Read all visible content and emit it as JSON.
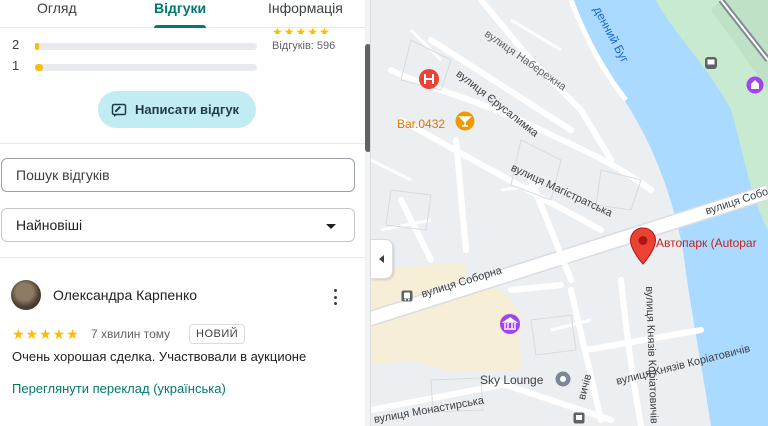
{
  "tabs": [
    {
      "label": "Огляд",
      "active": false
    },
    {
      "label": "Відгуки",
      "active": true
    },
    {
      "label": "Інформація",
      "active": false
    }
  ],
  "histogram": [
    {
      "label": "2",
      "fraction": 0.012
    },
    {
      "label": "1",
      "fraction": 0.035
    }
  ],
  "rating_summary": {
    "stars": "★★★★★",
    "reviews_label": "Відгуків:",
    "reviews_count": "596"
  },
  "write_review": {
    "label": "Написати відгук",
    "icon": "edit-review-icon"
  },
  "search": {
    "placeholder": "Пошук відгуків",
    "value": ""
  },
  "sort": {
    "selected": "Найновіші"
  },
  "review": {
    "author": "Олександра Карпенко",
    "stars": "★★★★★",
    "time": "7 хвилин тому",
    "badge": "НОВИЙ",
    "text": "Очень хорошая сделка. Участвовали в аукционе",
    "translate_link": "Переглянути переклад (українська)"
  },
  "map": {
    "labels": {
      "river": "денний Буг",
      "street_naberezhna": "вулиця Набережна",
      "street_yerusalymka": "вулиця Єрусалимка",
      "bar": "Bar.0432",
      "street_mahistratska": "вулиця Магістратська",
      "street_soborna_right": "вулиця Собо",
      "street_soborna": "вулиця Соборна",
      "place_name": "Автопарк (Autopar",
      "street_koriatovychiv": "вулиця Князів Коріатовичів",
      "sky_lounge": "Sky Lounge",
      "street_monastyrska": "вулиця Монастирська",
      "street_small": "вичів"
    },
    "icons": [
      "hospital-icon",
      "bar-icon",
      "bus-stop-icon",
      "museum-icon",
      "place-pin-icon",
      "lounge-icon",
      "transit-icon",
      "attraction-icon"
    ],
    "colors": {
      "water": "#aadaff",
      "park": "#c8ead0",
      "land": "#eceff1",
      "road": "#ffffff",
      "building_area": "#f6eed6",
      "pin": "#ea4335",
      "bar": "#f29900"
    }
  }
}
